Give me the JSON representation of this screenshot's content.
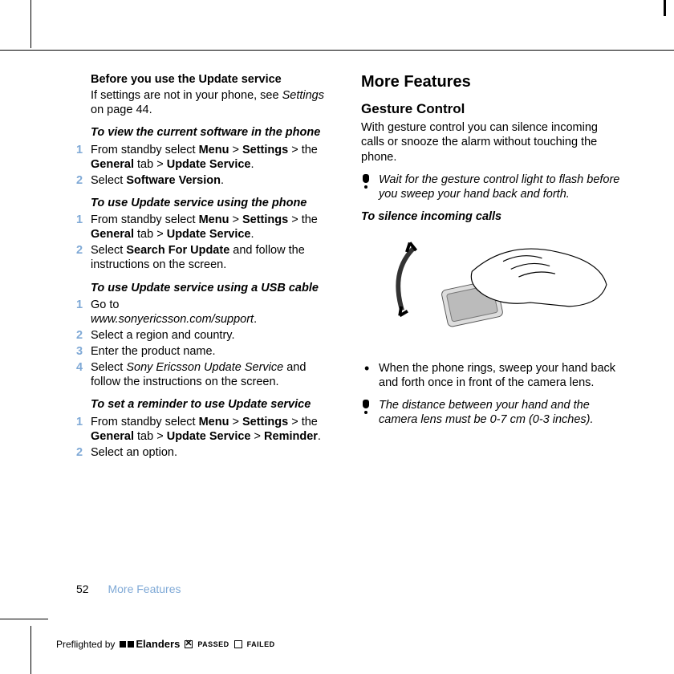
{
  "left": {
    "h_before": "Before you use the Update service",
    "intro_1": "If settings are not in your phone, see ",
    "intro_2": "Settings",
    "intro_3": " on page 44.",
    "s1_h": "To view the current software in the phone",
    "s1_1a": "From standby select ",
    "s1_1_menu": "Menu",
    "gt": " > ",
    "s1_1_settings": "Settings",
    "s1_1b": " > the ",
    "s1_1_general": "General",
    "s1_1c": " tab > ",
    "s1_1_update": "Update Service",
    "s1_1d": ".",
    "s1_2a": "Select ",
    "s1_2_sv": "Software Version",
    "s1_2b": ".",
    "s2_h": "To use Update service using the phone",
    "s2_2a": "Select ",
    "s2_2_sfu": "Search For Update",
    "s2_2b": " and follow the instructions on the screen.",
    "s3_h": "To use Update service using a USB cable",
    "s3_1a": "Go to",
    "s3_1_url": "www.sonyericsson.com/support",
    "s3_1b": ".",
    "s3_2": "Select a region and country.",
    "s3_3": "Enter the product name.",
    "s3_4a": "Select ",
    "s3_4_seus": "Sony Ericsson Update Service",
    "s3_4b": " and follow the instructions on the screen.",
    "s4_h": "To set a reminder to use Update service",
    "s4_1_rem": "Reminder",
    "s4_2": "Select an option."
  },
  "right": {
    "h2": "More Features",
    "h3": "Gesture Control",
    "p1": "With gesture control you can silence incoming calls or snooze the alarm without touching the phone.",
    "note1": "Wait for the gesture control light to flash before you sweep your hand back and forth.",
    "sub": "To silence incoming calls",
    "bul1": "When the phone rings, sweep your hand back and forth once in front of the camera lens.",
    "note2": "The distance between your hand and the camera lens must be 0-7 cm (0-3 inches)."
  },
  "footer": {
    "page": "52",
    "section": "More Features"
  },
  "preflight": {
    "by": "Preflighted by",
    "brand": "Elanders",
    "passed": "PASSED",
    "failed": "FAILED"
  },
  "nums": {
    "n1": "1",
    "n2": "2",
    "n3": "3",
    "n4": "4"
  }
}
